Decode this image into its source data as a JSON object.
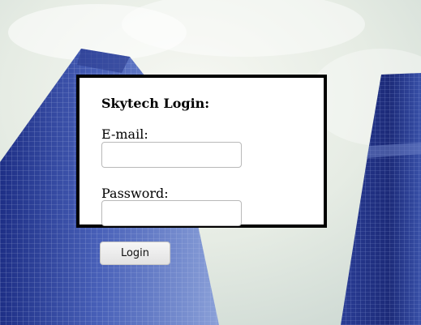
{
  "login": {
    "title": "Skytech Login:",
    "email_label": "E-mail:",
    "email_value": "",
    "password_label": "Password:",
    "password_value": "",
    "submit_label": "Login"
  },
  "background": {
    "sky_color": "#e6eee6",
    "glass_color": "#3a4fa8"
  }
}
